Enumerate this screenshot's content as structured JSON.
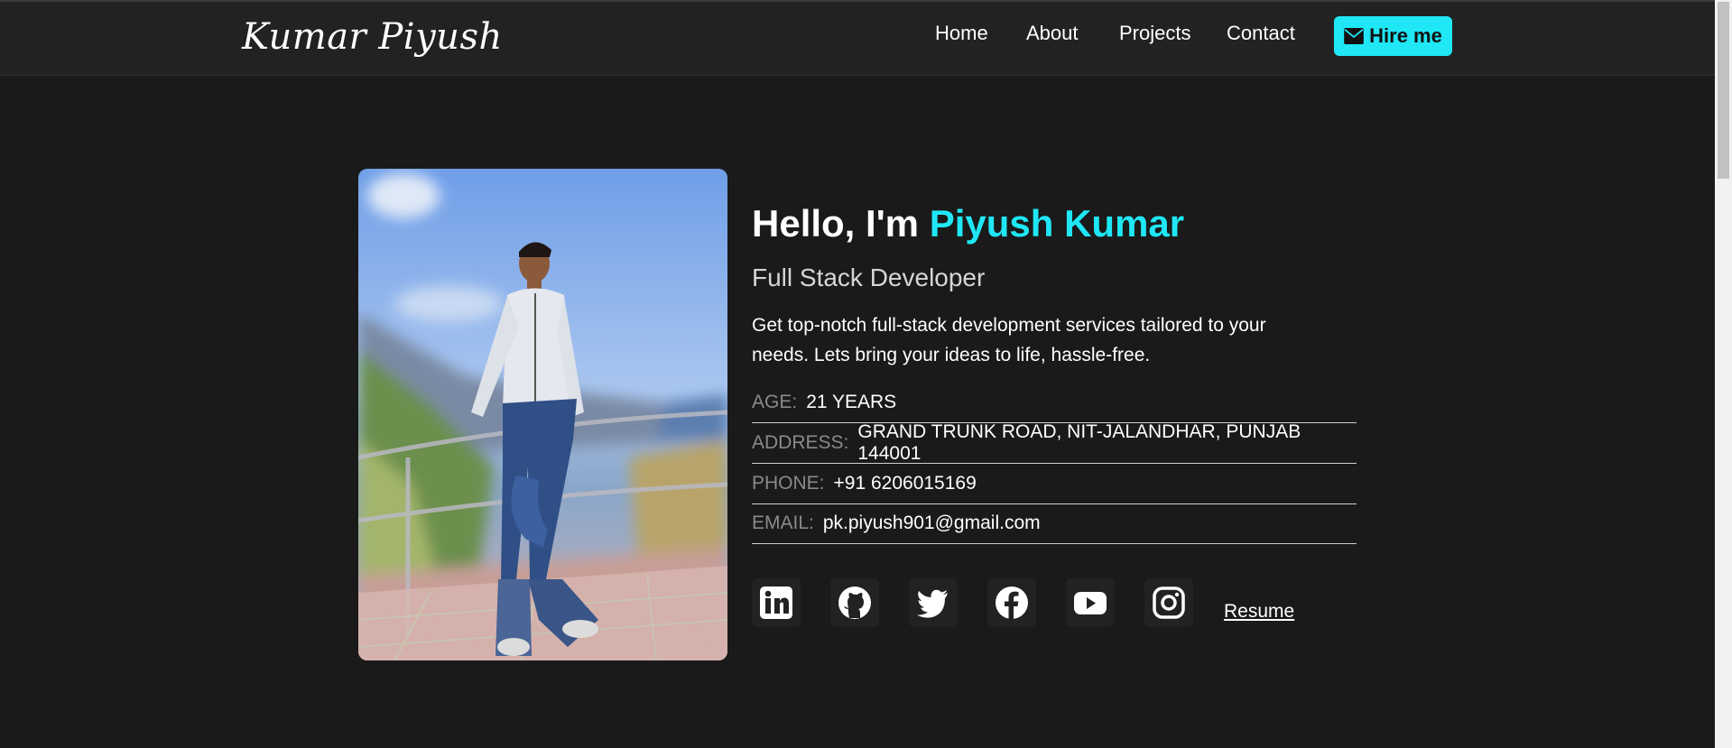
{
  "nav": {
    "brand": "Kumar Piyush",
    "links": [
      "Home",
      "About",
      "Projects",
      "Contact"
    ],
    "hire_label": "Hire me"
  },
  "hero": {
    "greeting": "Hello, I'm ",
    "name": "Piyush Kumar",
    "role": "Full Stack Developer",
    "description": "Get top-notch full-stack development services tailored to your needs. Lets bring your ideas to life, hassle-free.",
    "info": [
      {
        "label": "AGE:",
        "value": "21 YEARS"
      },
      {
        "label": "ADDRESS:",
        "value": "GRAND TRUNK ROAD, NIT-JALANDHAR, PUNJAB 144001"
      },
      {
        "label": "PHONE:",
        "value": "+91 6206015169"
      },
      {
        "label": "EMAIL:",
        "value": "pk.piyush901@gmail.com"
      }
    ],
    "socials": [
      "linkedin-icon",
      "github-icon",
      "twitter-icon",
      "facebook-icon",
      "youtube-icon",
      "instagram-icon"
    ],
    "resume_label": "Resume"
  },
  "colors": {
    "background": "#1a1a1a",
    "navbar": "#222222",
    "accent": "#1fe7f5"
  }
}
